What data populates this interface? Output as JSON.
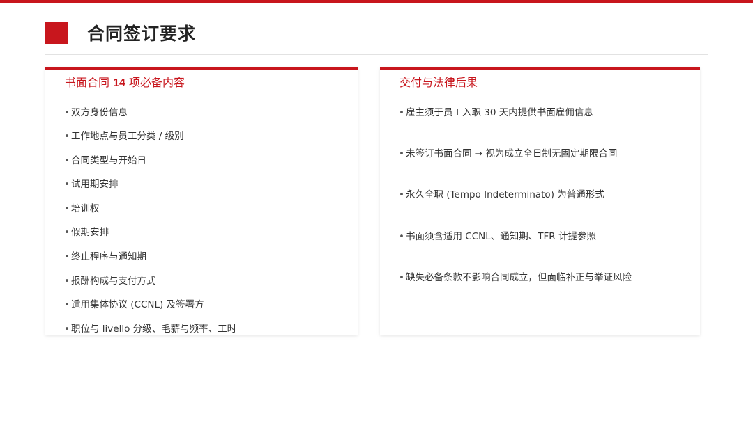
{
  "title": "合同签订要求",
  "left_card": {
    "heading_pre": "书面合同 ",
    "heading_num": "14",
    "heading_post": " 项必备内容",
    "items": [
      "双方身份信息",
      "工作地点与员工分类 / 级别",
      "合同类型与开始日",
      "试用期安排",
      "培训权",
      "假期安排",
      "终止程序与通知期",
      "报酬构成与支付方式",
      "适用集体协议 (CCNL) 及签署方",
      "职位与 livello 分级、毛薪与频率、工时"
    ]
  },
  "right_card": {
    "heading": "交付与法律后果",
    "items": [
      "雇主须于员工入职 30 天内提供书面雇佣信息",
      "未签订书面合同 → 视为成立全日制无固定期限合同",
      "永久全职 (Tempo Indeterminato) 为普通形式",
      "书面须含适用 CCNL、通知期、TFR 计提参照",
      "缺失必备条款不影响合同成立，但面临补正与举证风险"
    ]
  },
  "bullet": "•",
  "colors": {
    "accent": "#c8161d",
    "text": "#333333",
    "title": "#222222"
  }
}
